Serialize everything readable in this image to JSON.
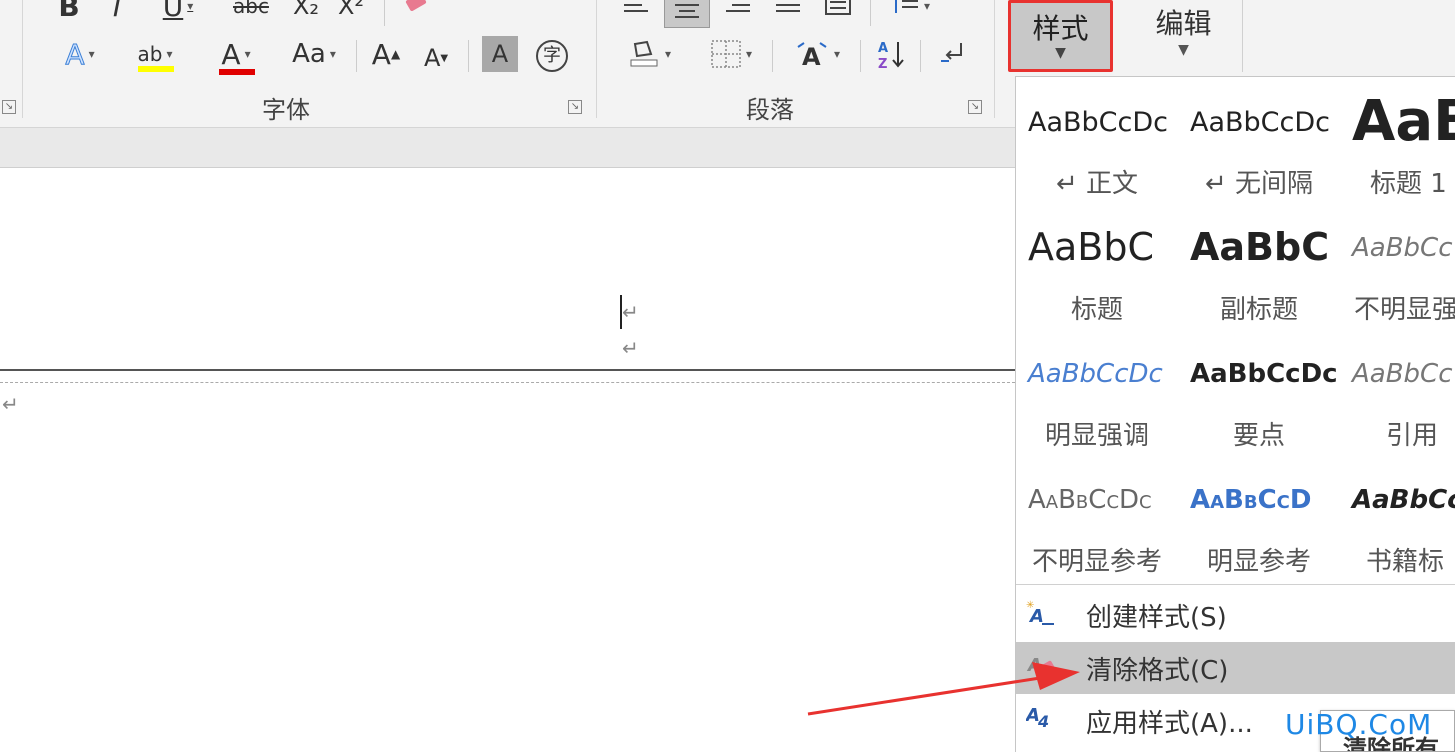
{
  "ribbon": {
    "font_group_label": "字体",
    "paragraph_group_label": "段落",
    "styles_button_label": "样式",
    "edit_button_label": "编辑",
    "font_tools": {
      "bold": "B",
      "italic": "I",
      "underline": "U",
      "strikethrough": "abc",
      "subscript": "X₂",
      "superscript": "X²",
      "text_effects": "A",
      "highlight": "ab",
      "font_color": "A",
      "change_case": "Aa",
      "grow_font": "A",
      "shrink_font": "A",
      "char_shading": "A",
      "enclose_char": "字"
    }
  },
  "gallery": {
    "tiles": [
      {
        "sample": "AaBbCcDc",
        "name": "↵ 正文"
      },
      {
        "sample": "AaBbCcDc",
        "name": "↵ 无间隔"
      },
      {
        "sample": "AaB",
        "name": "标题 1"
      },
      {
        "sample": "AaBbC",
        "name": "标题"
      },
      {
        "sample": "AaBbC",
        "name": "副标题"
      },
      {
        "sample": "AaBbCc",
        "name": "不明显强"
      },
      {
        "sample": "AaBbCcDc",
        "name": "明显强调"
      },
      {
        "sample": "AaBbCcDc",
        "name": "要点"
      },
      {
        "sample": "AaBbCc",
        "name": "引用"
      },
      {
        "sample": "AaBbCcDc",
        "name": "不明显参考"
      },
      {
        "sample": "AaBbCcD",
        "name": "明显参考"
      },
      {
        "sample": "AaBbCc",
        "name": "书籍标"
      }
    ],
    "menu": [
      {
        "label": "创建样式(S)",
        "icon": "create-style-icon"
      },
      {
        "label": "清除格式(C)",
        "icon": "clear-formatting-icon"
      },
      {
        "label": "应用样式(A)...",
        "icon": "apply-style-icon"
      }
    ]
  },
  "document": {
    "paragraph_mark": "↵"
  },
  "overlay": {
    "watermark": "UiBQ.CoM",
    "tooltip": "清除所有"
  },
  "colors": {
    "highlight_red": "#e8322f",
    "font_red": "#e00000",
    "highlight_yellow": "#ffff00",
    "accent_blue": "#2a5aa8"
  }
}
